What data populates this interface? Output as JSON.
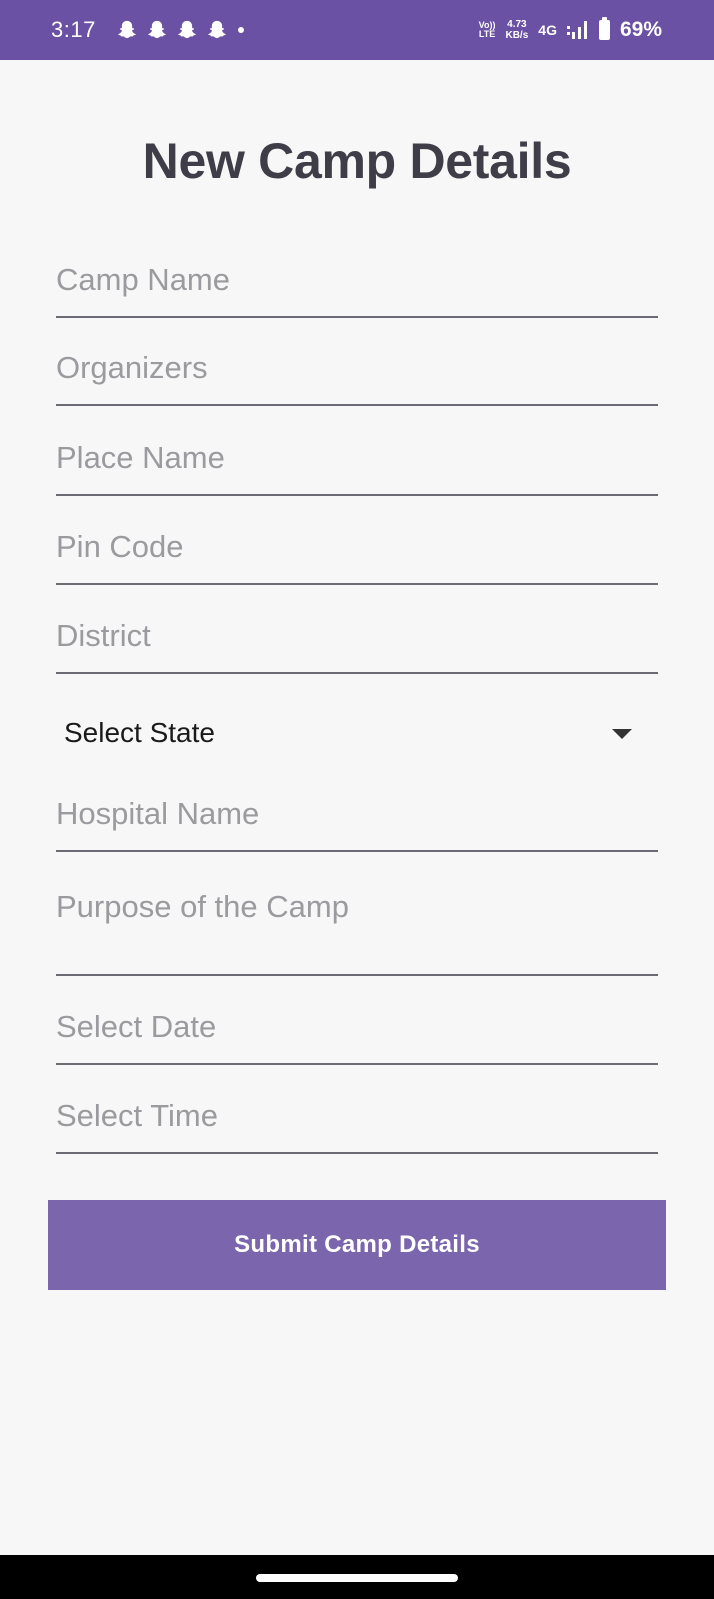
{
  "status_bar": {
    "time": "3:17",
    "notification_icons": [
      "snapchat-icon",
      "snapchat-icon",
      "snapchat-icon",
      "snapchat-icon"
    ],
    "volte_line1": "Vo))",
    "volte_line2": "LTE",
    "net_speed_value": "4.73",
    "net_speed_unit": "KB/s",
    "network_type": "4G",
    "battery_percent": "69%",
    "background_color": "#6a51a3"
  },
  "page": {
    "title": "New Camp Details"
  },
  "form": {
    "camp_name": {
      "placeholder": "Camp Name",
      "value": ""
    },
    "organizers": {
      "placeholder": "Organizers",
      "value": ""
    },
    "place_name": {
      "placeholder": "Place Name",
      "value": ""
    },
    "pin_code": {
      "placeholder": "Pin Code",
      "value": ""
    },
    "district": {
      "placeholder": "District",
      "value": ""
    },
    "state_select": {
      "selected": "Select State"
    },
    "hospital_name": {
      "placeholder": "Hospital Name",
      "value": ""
    },
    "purpose": {
      "placeholder": "Purpose of the Camp",
      "value": ""
    },
    "select_date": {
      "placeholder": "Select Date",
      "value": ""
    },
    "select_time": {
      "placeholder": "Select Time",
      "value": ""
    },
    "submit_label": "Submit Camp Details",
    "submit_color": "#7b66ae"
  }
}
